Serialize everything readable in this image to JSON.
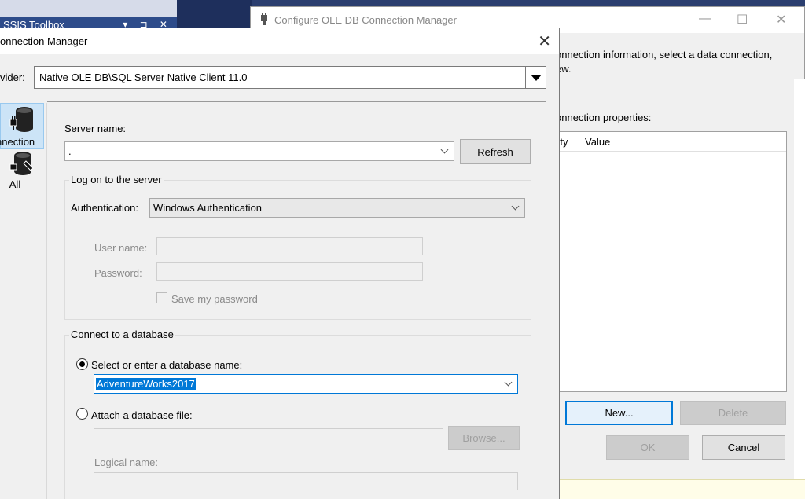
{
  "background": {
    "toolbox_tab": "SSIS Toolbox",
    "toolbox_tab_buttons": "▾ ⊐ ✕"
  },
  "configure_dialog": {
    "title": "Configure OLE DB Connection Manager",
    "description_line1": "onnection information, select a data connection,",
    "description_line2": "ew.",
    "connection_properties_label": "onnection properties:",
    "grid_columns": [
      "rty",
      "Value"
    ],
    "new_button": "New...",
    "delete_button": "Delete",
    "ok_button": "OK",
    "cancel_button": "Cancel"
  },
  "connection_manager": {
    "title": "onnection Manager",
    "provider_label": "vider:",
    "provider_value": "Native OLE DB\\SQL Server Native Client 11.0",
    "sidebar": {
      "connection_label": "nnection",
      "all_label": "All"
    },
    "server_name_label": "Server name:",
    "server_name_value": ".",
    "refresh_button": "Refresh",
    "logon_group": {
      "caption": "Log on to the server",
      "authentication_label": "Authentication:",
      "authentication_value": "Windows Authentication",
      "username_label": "User name:",
      "password_label": "Password:",
      "save_password_label": "Save my password"
    },
    "database_group": {
      "caption": "Connect to a database",
      "select_db_label": "Select or enter a database name:",
      "db_value": "AdventureWorks2017",
      "attach_label": "Attach a database file:",
      "browse_button": "Browse...",
      "logical_name_label": "Logical name:"
    }
  }
}
